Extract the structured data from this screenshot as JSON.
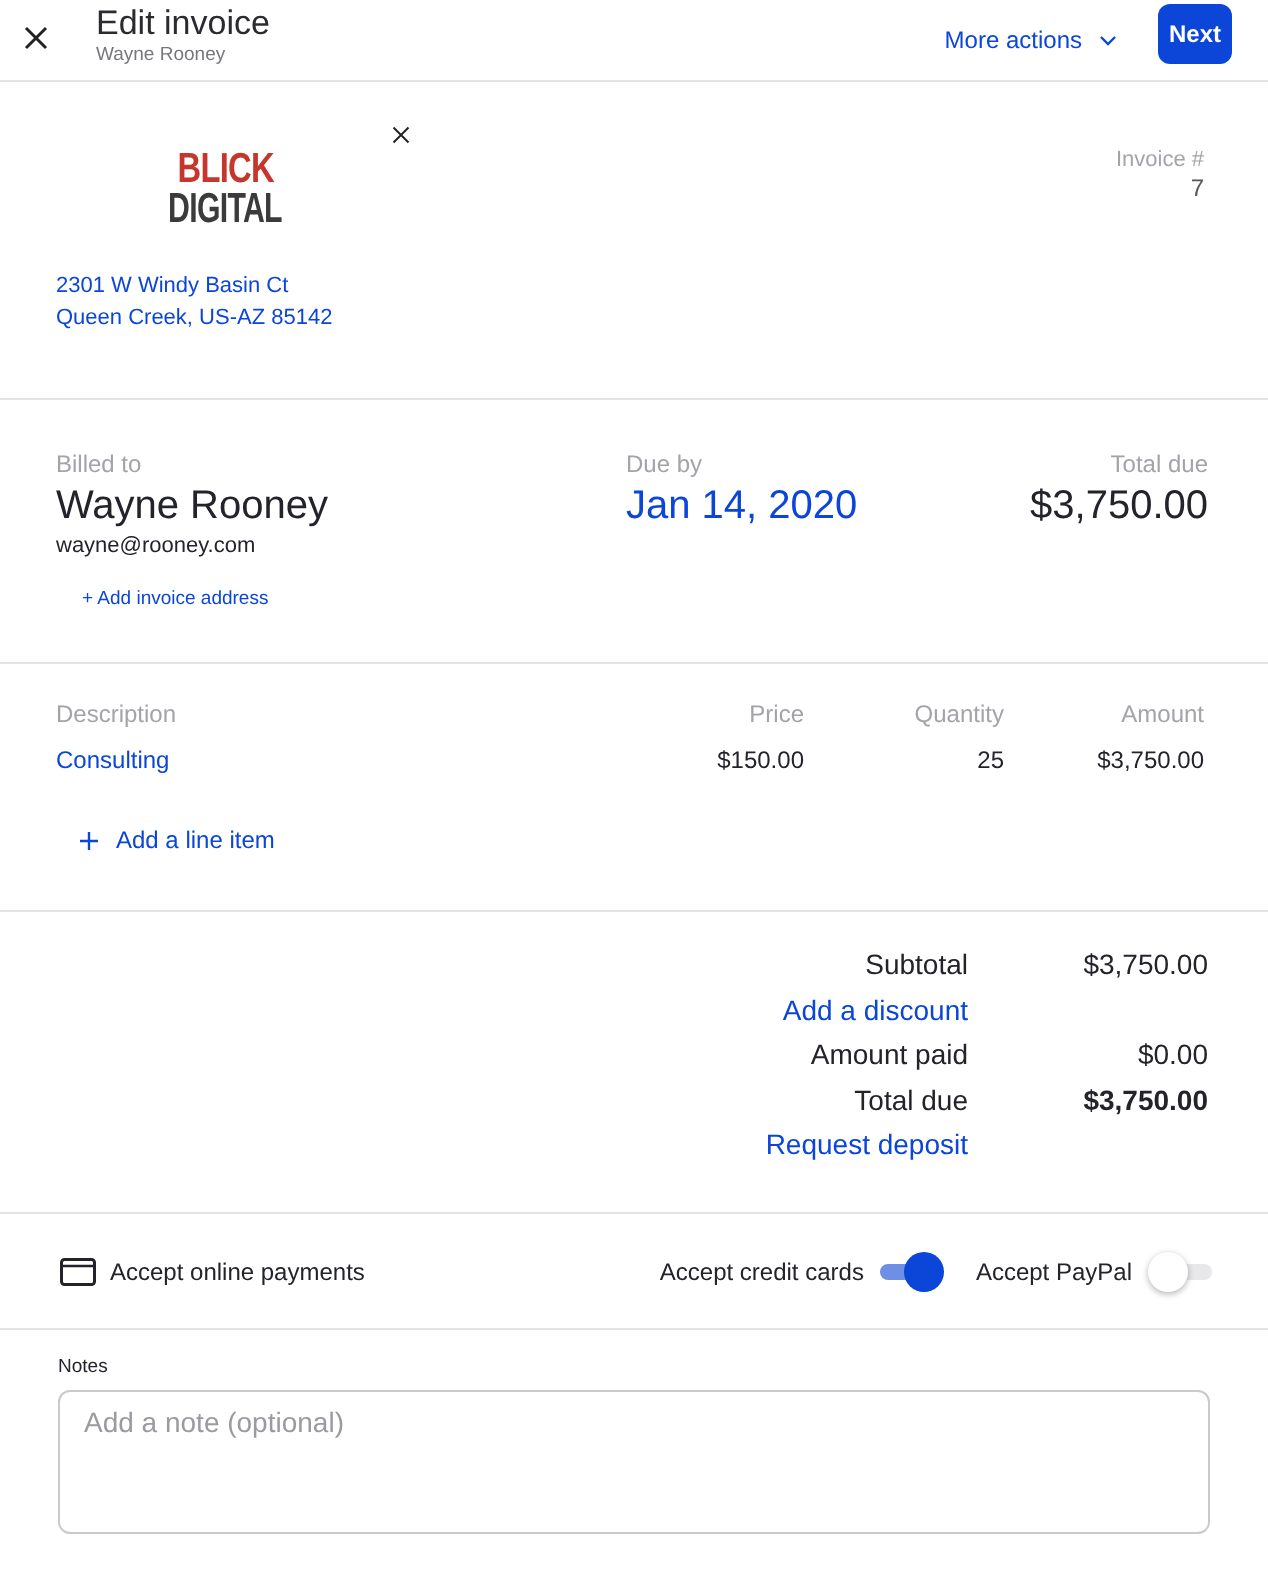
{
  "header": {
    "title": "Edit invoice",
    "subtitle": "Wayne Rooney",
    "more_actions": "More actions",
    "next_button": "Next"
  },
  "business": {
    "logo": {
      "line_1": "BLICK",
      "line_2": "DIGITAL"
    },
    "address": [
      "2301 W Windy Basin Ct",
      "Queen Creek, US-AZ 85142"
    ],
    "invoice_number": {
      "label": "Invoice #",
      "value": "7"
    }
  },
  "summary": {
    "billed_to": {
      "label": "Billed to",
      "name": "Wayne Rooney",
      "email": "wayne@rooney.com",
      "add_address_link": "+ Add invoice address"
    },
    "due_by": {
      "label": "Due by",
      "value": "Jan 14, 2020"
    },
    "total_due": {
      "label": "Total due",
      "value": "$3,750.00"
    }
  },
  "line_items": {
    "columns": [
      "Description",
      "Price",
      "Quantity",
      "Amount"
    ],
    "rows": [
      {
        "description": "Consulting",
        "price": "$150.00",
        "quantity": "25",
        "amount": "$3,750.00"
      }
    ],
    "add_link": "Add a line item"
  },
  "totals": [
    {
      "kind": "value",
      "label": "Subtotal",
      "value": "$3,750.00"
    },
    {
      "kind": "link",
      "label": "Add a discount"
    },
    {
      "kind": "value",
      "label": "Amount paid",
      "value": "$0.00"
    },
    {
      "kind": "total",
      "label": "Total due",
      "value": "$3,750.00"
    },
    {
      "kind": "link",
      "label": "Request deposit"
    }
  ],
  "payments": {
    "label": "Accept online payments",
    "toggles": [
      {
        "label": "Accept credit cards",
        "on": true
      },
      {
        "label": "Accept PayPal",
        "on": false
      }
    ]
  },
  "notes": {
    "label": "Notes",
    "placeholder": "Add a note (optional)"
  }
}
